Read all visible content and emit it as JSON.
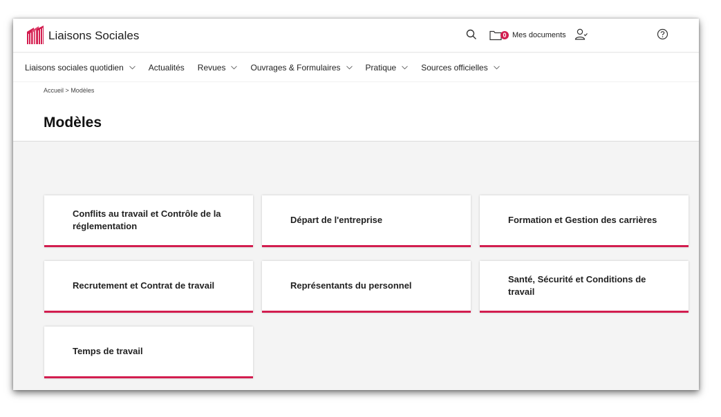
{
  "app": {
    "brand": "Liaisons Sociales",
    "brand_color": "#d21d4f"
  },
  "topbar": {
    "search_icon": "search-icon",
    "docs_badge": "0",
    "docs_label": "Mes documents",
    "user_icon": "user-check-icon",
    "help_icon": "help-circle-icon"
  },
  "nav": {
    "items": [
      {
        "label": "Liaisons sociales quotidien",
        "dropdown": true
      },
      {
        "label": "Actualités",
        "dropdown": false
      },
      {
        "label": "Revues",
        "dropdown": true
      },
      {
        "label": "Ouvrages & Formulaires",
        "dropdown": true
      },
      {
        "label": "Pratique",
        "dropdown": true
      },
      {
        "label": "Sources officielles",
        "dropdown": true
      }
    ]
  },
  "breadcrumb": {
    "home": "Accueil",
    "separator": ">",
    "current": "Modèles"
  },
  "page": {
    "title": "Modèles"
  },
  "cards": [
    {
      "label": "Conflits au travail et Contrôle de la réglementation"
    },
    {
      "label": "Départ de l'entreprise"
    },
    {
      "label": "Formation et Gestion des carrières"
    },
    {
      "label": "Recrutement et Contrat de travail"
    },
    {
      "label": "Représentants du personnel"
    },
    {
      "label": "Santé, Sécurité et Conditions de travail"
    },
    {
      "label": "Temps de travail"
    }
  ]
}
